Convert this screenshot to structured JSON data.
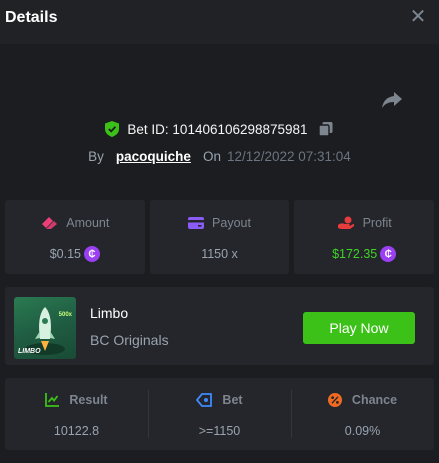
{
  "header": {
    "title": "Details"
  },
  "bet": {
    "id_text": "Bet ID: 101406106298875981",
    "by_label": "By",
    "username": "pacoquiche",
    "on_label": "On",
    "datetime": "12/12/2022 07:31:04"
  },
  "stats": [
    {
      "label": "Amount",
      "value": "$0.15",
      "coin": true,
      "icon": "amount-icon",
      "color": "#ec3f78"
    },
    {
      "label": "Payout",
      "value": "1150 x",
      "coin": false,
      "icon": "wallet-icon",
      "color": "#8a5cf6"
    },
    {
      "label": "Profit",
      "value": "$172.35",
      "coin": true,
      "icon": "profit-icon",
      "color": "#e83b3b"
    }
  ],
  "coin_symbol": "₵",
  "game": {
    "name": "Limbo",
    "provider": "BC Originals",
    "play_label": "Play Now",
    "thumb_logo": "LIMBO",
    "thumb_mult": "500x"
  },
  "results": [
    {
      "label": "Result",
      "value": "10122.8",
      "icon": "result-icon",
      "color": "#3bc117"
    },
    {
      "label": "Bet",
      "value": ">=1150",
      "icon": "tag-icon",
      "color": "#3d8bff"
    },
    {
      "label": "Chance",
      "value": "0.09%",
      "icon": "percent-icon",
      "color": "#f26a22"
    }
  ],
  "colors": {
    "accent_green": "#3bc117",
    "profit_green": "#3fd424",
    "coin_purple": "#9b3ff3"
  }
}
